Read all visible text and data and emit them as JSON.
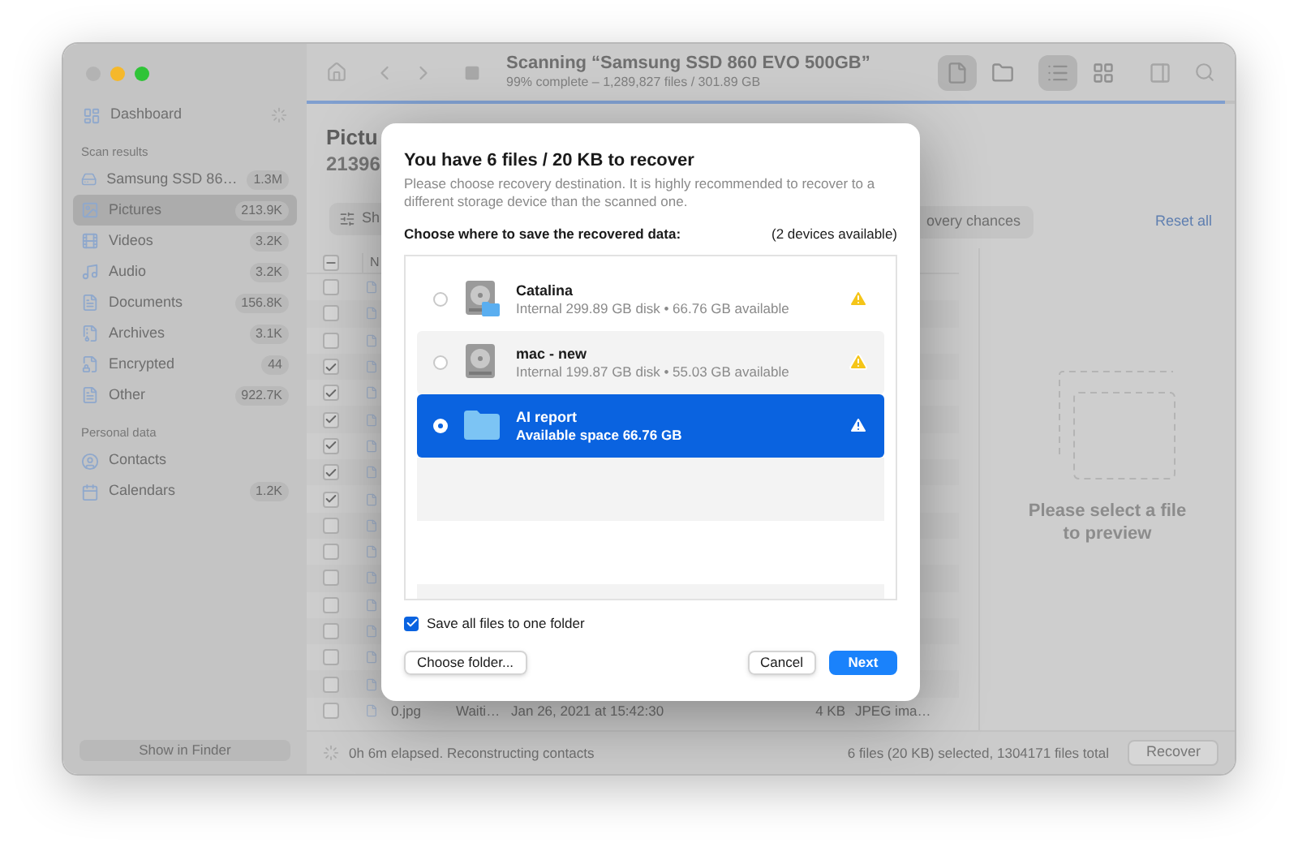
{
  "window": {
    "title": "Scanning “Samsung SSD 860 EVO 500GB”",
    "subtitle": "99% complete – 1,289,827 files / 301.89 GB",
    "progress": {
      "level": 0.99
    }
  },
  "toolbar": {
    "item_views": [
      {
        "kind": "file",
        "selected": true
      },
      {
        "kind": "folder",
        "selected": false
      }
    ],
    "layouts": [
      {
        "kind": "list",
        "selected": true
      },
      {
        "kind": "grid",
        "selected": false
      }
    ]
  },
  "sidebar": {
    "dashboard": "Dashboard",
    "sections": [
      {
        "heading": "Scan results",
        "items": [
          {
            "kind": "drive",
            "label": "Samsung SSD 86…",
            "count": "1.3M",
            "selected": false
          },
          {
            "kind": "pictures",
            "label": "Pictures",
            "count": "213.9K",
            "selected": true
          },
          {
            "kind": "videos",
            "label": "Videos",
            "count": "3.2K",
            "selected": false
          },
          {
            "kind": "audio",
            "label": "Audio",
            "count": "3.2K",
            "selected": false
          },
          {
            "kind": "documents",
            "label": "Documents",
            "count": "156.8K",
            "selected": false
          },
          {
            "kind": "archives",
            "label": "Archives",
            "count": "3.1K",
            "selected": false
          },
          {
            "kind": "encrypted",
            "label": "Encrypted",
            "count": "44",
            "selected": false
          },
          {
            "kind": "other",
            "label": "Other",
            "count": "922.7K",
            "selected": false
          }
        ]
      },
      {
        "heading": "Personal data",
        "items": [
          {
            "kind": "contacts",
            "label": "Contacts",
            "selected": false
          },
          {
            "kind": "calendars",
            "label": "Calendars",
            "count": "1.2K",
            "selected": false
          }
        ]
      }
    ],
    "show_in_finder": "Show in Finder"
  },
  "content": {
    "title": "Pictu",
    "count": "21396",
    "filter_button": "Sh",
    "chip": "overy chances",
    "reset": "Reset all",
    "table": {
      "columns": [
        "N"
      ],
      "indeterminate": true,
      "rows": [
        {
          "checked": false
        },
        {
          "checked": false
        },
        {
          "checked": false
        },
        {
          "checked": true
        },
        {
          "checked": true
        },
        {
          "checked": true
        },
        {
          "checked": true
        },
        {
          "checked": true
        },
        {
          "checked": true
        },
        {
          "checked": false
        },
        {
          "checked": false
        },
        {
          "checked": false
        },
        {
          "checked": false
        },
        {
          "checked": false
        },
        {
          "checked": false
        },
        {
          "checked": false
        },
        {
          "checked": false,
          "name": "0.jpg",
          "status": "Waiti…",
          "date": "Jan 26, 2021 at 15:42:30",
          "size": "4 KB",
          "type": "JPEG ima…"
        }
      ]
    }
  },
  "preview": {
    "message": "Please select a file to preview"
  },
  "status_bar": {
    "elapsed": "0h 6m elapsed. Reconstructing contacts",
    "selection": "6 files (20 KB) selected, 1304171 files total",
    "recover": "Recover"
  },
  "dialog": {
    "title": "You have 6 files / 20 KB to recover",
    "description": "Please choose recovery destination. It is highly recommended to recover to a different storage device than the scanned one.",
    "prompt": "Choose where to save the recovered data:",
    "available": "(2 devices available)",
    "destinations": [
      {
        "kind": "system_disk",
        "name": "Catalina",
        "detail": "Internal 299.89 GB disk • 66.76 GB available",
        "selected": false,
        "warning": true
      },
      {
        "kind": "disk",
        "name": "mac - new",
        "detail": "Internal 199.87 GB disk • 55.03 GB available",
        "selected": false,
        "warning": true
      },
      {
        "kind": "folder",
        "name": "AI report",
        "detail": "Available space 66.76 GB",
        "selected": true,
        "warning": true
      }
    ],
    "one_folder": {
      "label": "Save all files to one folder",
      "checked": true
    },
    "buttons": {
      "choose": "Choose folder...",
      "cancel": "Cancel",
      "next": "Next"
    }
  }
}
